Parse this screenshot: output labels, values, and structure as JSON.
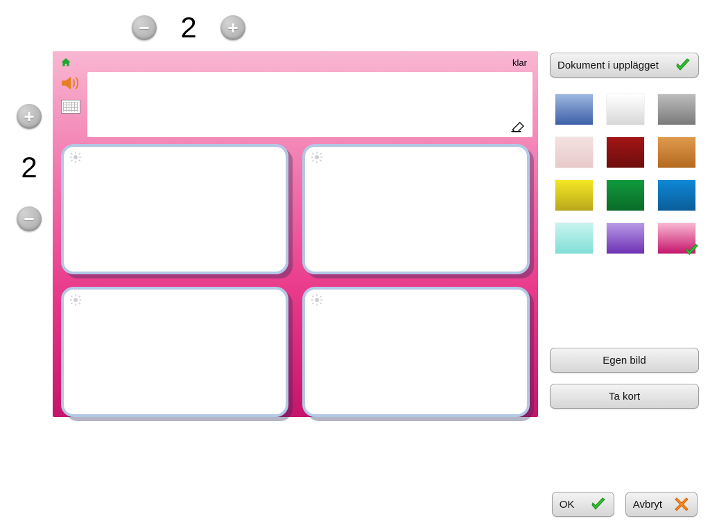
{
  "columns": {
    "value": "2"
  },
  "rows": {
    "value": "2"
  },
  "canvas": {
    "klar_label": "klar"
  },
  "right": {
    "document_in_layout": "Dokument i upplägget",
    "own_image": "Egen bild",
    "take_photo": "Ta kort"
  },
  "footer": {
    "ok": "OK",
    "cancel": "Avbryt"
  },
  "swatches": [
    {
      "css": "linear-gradient(180deg,#9db8e0,#3c5fa8)",
      "selected": false
    },
    {
      "css": "linear-gradient(180deg,#ffffff,#d8d8d8)",
      "selected": false
    },
    {
      "css": "linear-gradient(180deg,#bdbdbd,#7a7a7a)",
      "selected": false
    },
    {
      "css": "linear-gradient(180deg,#f4e1e1,#e9c9c9)",
      "selected": false
    },
    {
      "css": "linear-gradient(180deg,#a31515,#6d0d0d)",
      "selected": false
    },
    {
      "css": "linear-gradient(180deg,#e09a4d,#b36a1f)",
      "selected": false
    },
    {
      "css": "linear-gradient(180deg,#f4e723,#b9a81b)",
      "selected": false
    },
    {
      "css": "linear-gradient(180deg,#0f9a3c,#0a6b29)",
      "selected": false
    },
    {
      "css": "linear-gradient(180deg,#0f87d6,#0a5e99)",
      "selected": false
    },
    {
      "css": "linear-gradient(180deg,#c9f3ef,#7fdfd6)",
      "selected": false
    },
    {
      "css": "linear-gradient(180deg,#b79ae6,#6d30b3)",
      "selected": false
    },
    {
      "css": "linear-gradient(180deg,#f9b7d2,#c5156b)",
      "selected": true
    }
  ]
}
